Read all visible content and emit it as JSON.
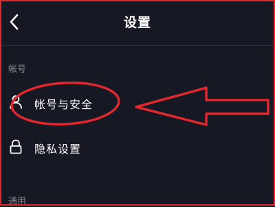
{
  "header": {
    "title": "设置",
    "back_icon": "chevron-left-icon"
  },
  "sections": {
    "account": {
      "label": "帐号",
      "items": [
        {
          "label": "帐号与安全",
          "icon": "person-icon"
        },
        {
          "label": "隐私设置",
          "icon": "lock-icon"
        }
      ]
    },
    "general": {
      "label": "通用"
    }
  },
  "colors": {
    "background": "#161823",
    "text": "#ffffff",
    "muted": "#8a8b91",
    "annotation": "#e0282e"
  }
}
